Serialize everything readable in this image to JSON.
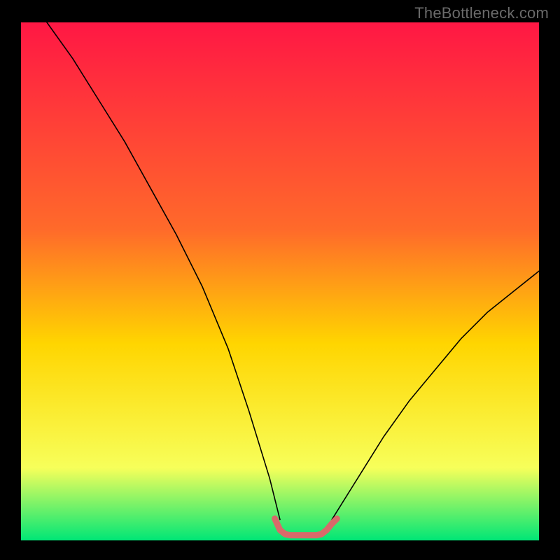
{
  "watermark": "TheBottleneck.com",
  "chart_data": {
    "type": "line",
    "title": "",
    "xlabel": "",
    "ylabel": "",
    "xlim": [
      0,
      100
    ],
    "ylim": [
      0,
      100
    ],
    "grid": false,
    "legend": false,
    "background_gradient": {
      "start": "#ff1744",
      "mid1": "#ff6a2a",
      "mid2": "#ffd500",
      "mid3": "#f7ff5a",
      "end": "#00e676"
    },
    "series": [
      {
        "name": "left-branch",
        "x": [
          5,
          10,
          15,
          20,
          25,
          30,
          35,
          40,
          44,
          48,
          50
        ],
        "y": [
          100,
          93,
          85,
          77,
          68,
          59,
          49,
          37,
          25,
          12,
          4
        ],
        "stroke": "#000000",
        "stroke_width": 1.6
      },
      {
        "name": "right-branch",
        "x": [
          60,
          65,
          70,
          75,
          80,
          85,
          90,
          95,
          100
        ],
        "y": [
          4,
          12,
          20,
          27,
          33,
          39,
          44,
          48,
          52
        ],
        "stroke": "#000000",
        "stroke_width": 1.6
      },
      {
        "name": "bottom-arc",
        "x": [
          49,
          50,
          51,
          52,
          53,
          54,
          55,
          56,
          57,
          58,
          59,
          60,
          61
        ],
        "y": [
          4.2,
          2.0,
          1.2,
          1.0,
          1.0,
          1.0,
          1.0,
          1.0,
          1.0,
          1.2,
          2.0,
          3.2,
          4.2
        ],
        "stroke": "#d86a6a",
        "stroke_width": 9
      }
    ]
  }
}
